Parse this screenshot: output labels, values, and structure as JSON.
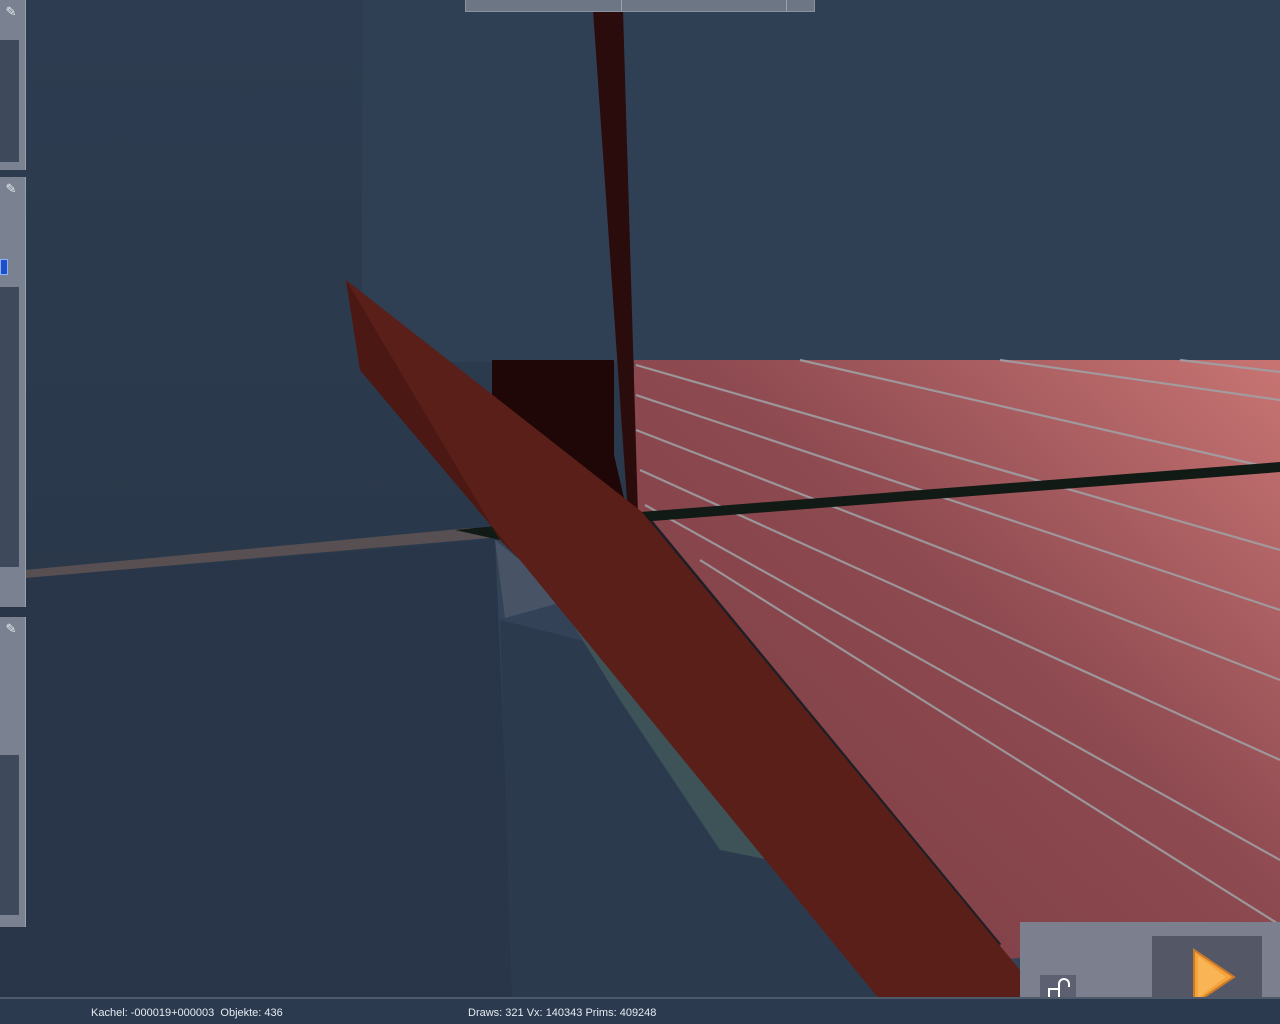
{
  "status": {
    "tile_label": "Kachel:",
    "tile_value": "-000019+000003",
    "objects_label": "Objekte:",
    "objects_value": "436",
    "draws_label": "Draws:",
    "draws_value": "321",
    "vx_label": "Vx:",
    "vx_value": "140343",
    "prims_label": "Prims:",
    "prims_value": "409248"
  },
  "icons": {
    "pin": "pin-icon",
    "lock": "unlock-icon",
    "play": "play-icon"
  },
  "colors": {
    "sky": "#2c3a4d",
    "roof": "#b85c5c",
    "beam": "#5a1e18",
    "accent_play": "#f5a23a",
    "status_text": "#e6ebf2"
  }
}
